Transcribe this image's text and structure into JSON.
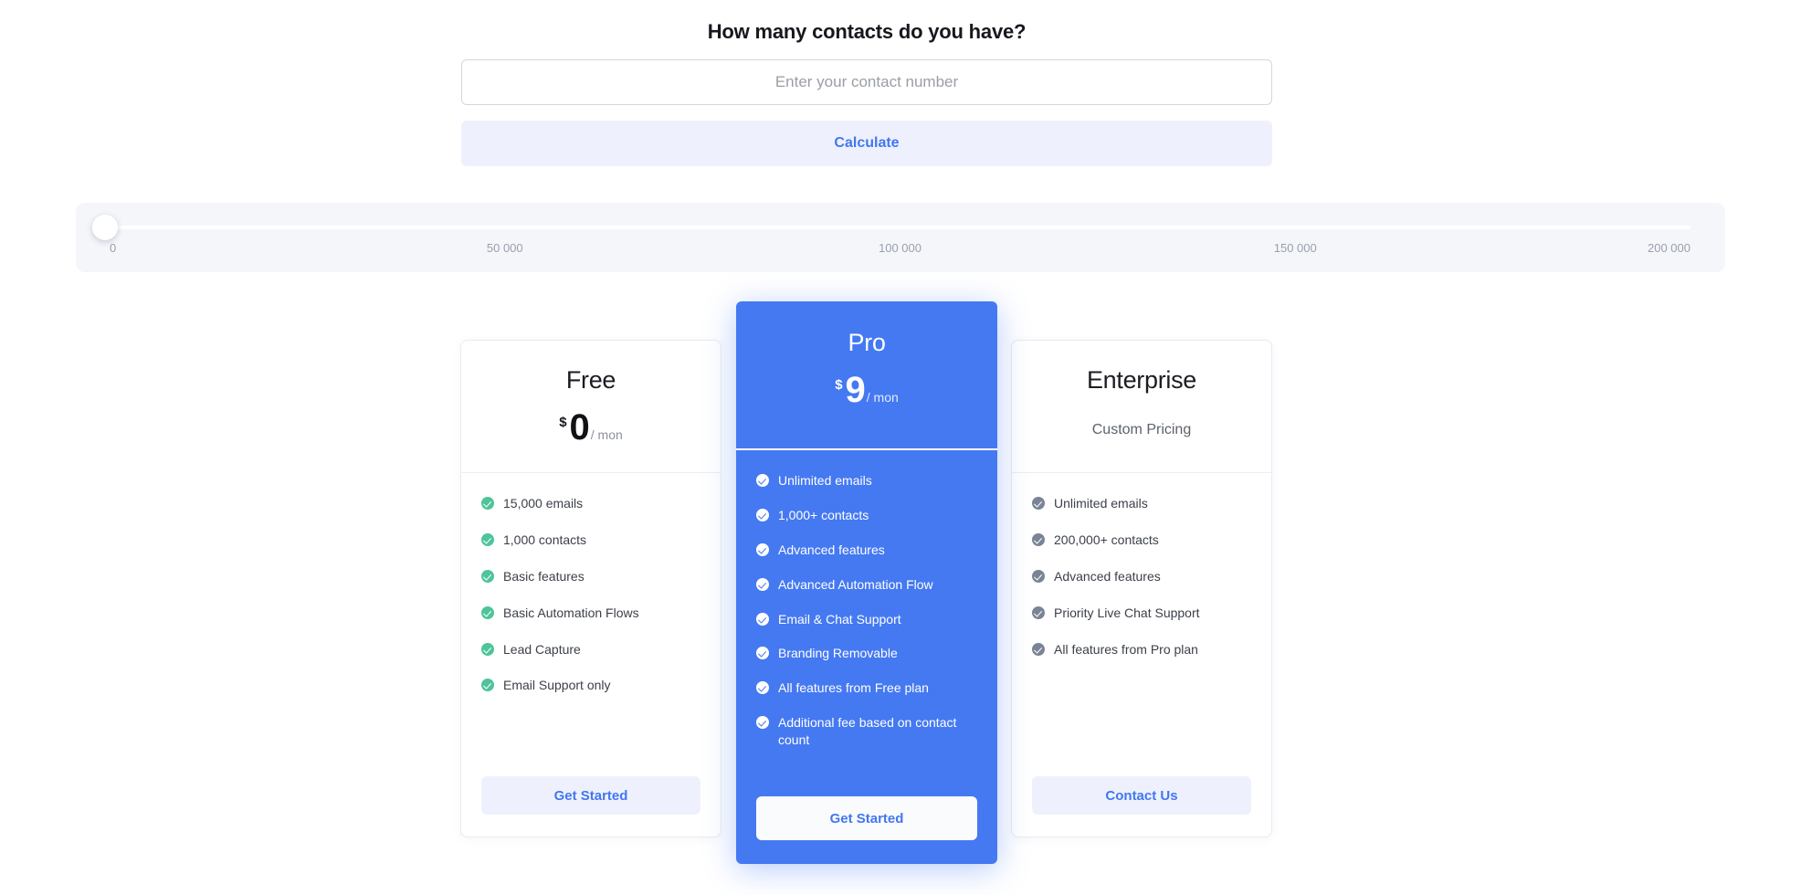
{
  "calculator": {
    "title": "How many contacts do you have?",
    "input_placeholder": "Enter your contact number",
    "input_value": "",
    "calculate_label": "Calculate"
  },
  "slider": {
    "value": 0,
    "min": 0,
    "max": 200000,
    "ticks": [
      "0",
      "50 000",
      "100 000",
      "150 000",
      "200 000"
    ]
  },
  "plans": [
    {
      "name": "Free",
      "currency": "$",
      "amount": "0",
      "period": "/ mon",
      "features": [
        "15,000 emails",
        "1,000 contacts",
        "Basic features",
        "Basic Automation Flows",
        "Lead Capture",
        "Email Support only"
      ],
      "cta": "Get Started"
    },
    {
      "name": "Pro",
      "currency": "$",
      "amount": "9",
      "period": "/ mon",
      "features": [
        "Unlimited emails",
        "1,000+ contacts",
        "Advanced features",
        "Advanced Automation Flow",
        "Email & Chat Support",
        "Branding Removable",
        "All features from Free plan",
        "Additional fee based on contact count"
      ],
      "cta": "Get Started",
      "highlighted": true
    },
    {
      "name": "Enterprise",
      "pricing_text": "Custom Pricing",
      "features": [
        "Unlimited emails",
        "200,000+ contacts",
        "Advanced features",
        "Priority Live Chat Support",
        "All features from Pro plan"
      ],
      "cta": "Contact Us"
    }
  ],
  "colors": {
    "accent": "#4579f2",
    "accent_soft": "#eef1fd",
    "check_free": "#4fc49a",
    "check_enterprise": "#7b8494",
    "panel_bg": "#f4f6fa"
  }
}
